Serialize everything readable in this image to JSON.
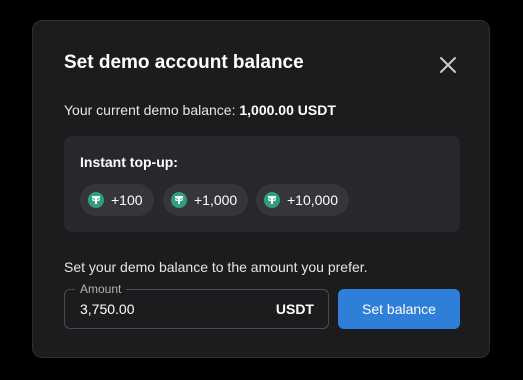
{
  "dialog": {
    "title": "Set demo account balance",
    "close_icon": "close-icon"
  },
  "balance": {
    "label": "Your current demo balance:",
    "value": "1,000.00 USDT"
  },
  "topup": {
    "title": "Instant top-up:",
    "coin_icon": "tether-icon",
    "options": [
      {
        "label": "+100"
      },
      {
        "label": "+1,000"
      },
      {
        "label": "+10,000"
      }
    ]
  },
  "custom": {
    "hint": "Set your demo balance to the amount you prefer.",
    "amount_label": "Amount",
    "amount_value": "3,750.00",
    "currency": "USDT",
    "button_label": "Set balance"
  },
  "colors": {
    "modal_bg": "#1b1c1e",
    "card_bg": "#27282b",
    "chip_bg": "#35363a",
    "coin": "#2ea07b",
    "accent": "#2f7fd9"
  }
}
